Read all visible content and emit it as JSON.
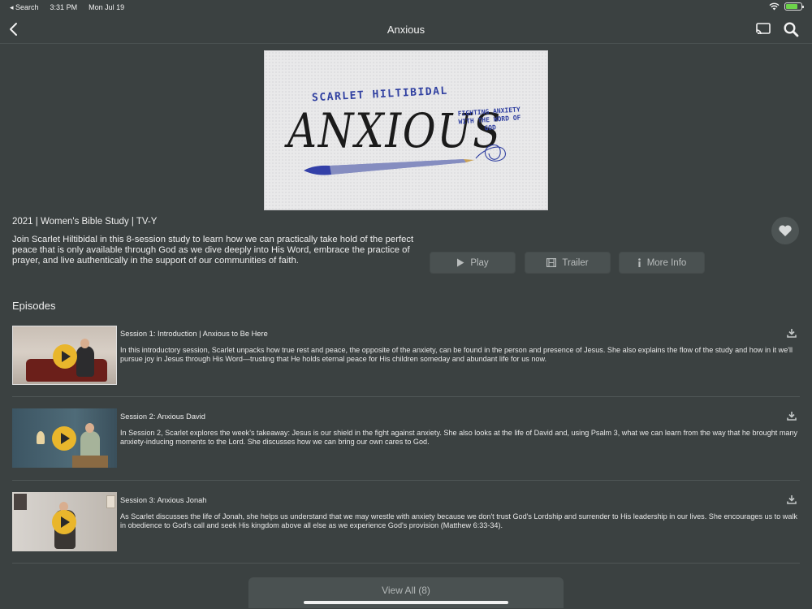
{
  "status_bar": {
    "back_app": "◂ Search",
    "time": "3:31 PM",
    "date": "Mon Jul 19"
  },
  "nav": {
    "title": "Anxious"
  },
  "hero": {
    "author": "SCARLET HILTIBIDAL",
    "title_art": "ANXIOUS",
    "tagline": "FIGHTING ANXIETY WITH THE WORD OF GOD"
  },
  "series": {
    "meta": "2021 | Women's Bible Study | TV-Y",
    "description": "Join Scarlet Hiltibidal in this 8-session study to learn how we can practically take hold of the perfect peace that is only available through God as we dive deeply into His Word, embrace the practice of prayer, and live authentically in the support of our communities of faith."
  },
  "actions": {
    "play": "Play",
    "trailer": "Trailer",
    "more_info": "More Info"
  },
  "episodes_heading": "Episodes",
  "episodes": [
    {
      "title": "Session 1: Introduction | Anxious to Be Here",
      "description": "In this introductory session, Scarlet unpacks how true rest and peace, the opposite of the anxiety, can be found in the person and presence of Jesus. She also explains the flow of the study and how in it we'll pursue joy in Jesus through His Word—trusting that He holds eternal peace for His children someday and abundant life for us now."
    },
    {
      "title": "Session 2: Anxious David",
      "description": "In Session 2, Scarlet explores the week's takeaway: Jesus is our shield in the fight against anxiety. She also looks at the life of David and, using Psalm 3, what we can learn from the way that he brought many anxiety-inducing moments to the Lord. She discusses how we can bring our own cares to God."
    },
    {
      "title": "Session 3: Anxious Jonah",
      "description": "As Scarlet discusses the life of Jonah, she helps us understand that we may wrestle with anxiety because we don't trust God's Lordship and surrender to His leadership in our lives. She encourages us to walk in obedience to God's call and seek His kingdom above all else as we experience God's provision (Matthew 6:33-34)."
    }
  ],
  "view_all": "View All (8)",
  "colors": {
    "background": "#3b4141",
    "button": "#4a5151",
    "play_accent": "#e9b62c",
    "battery": "#6dd34a"
  }
}
